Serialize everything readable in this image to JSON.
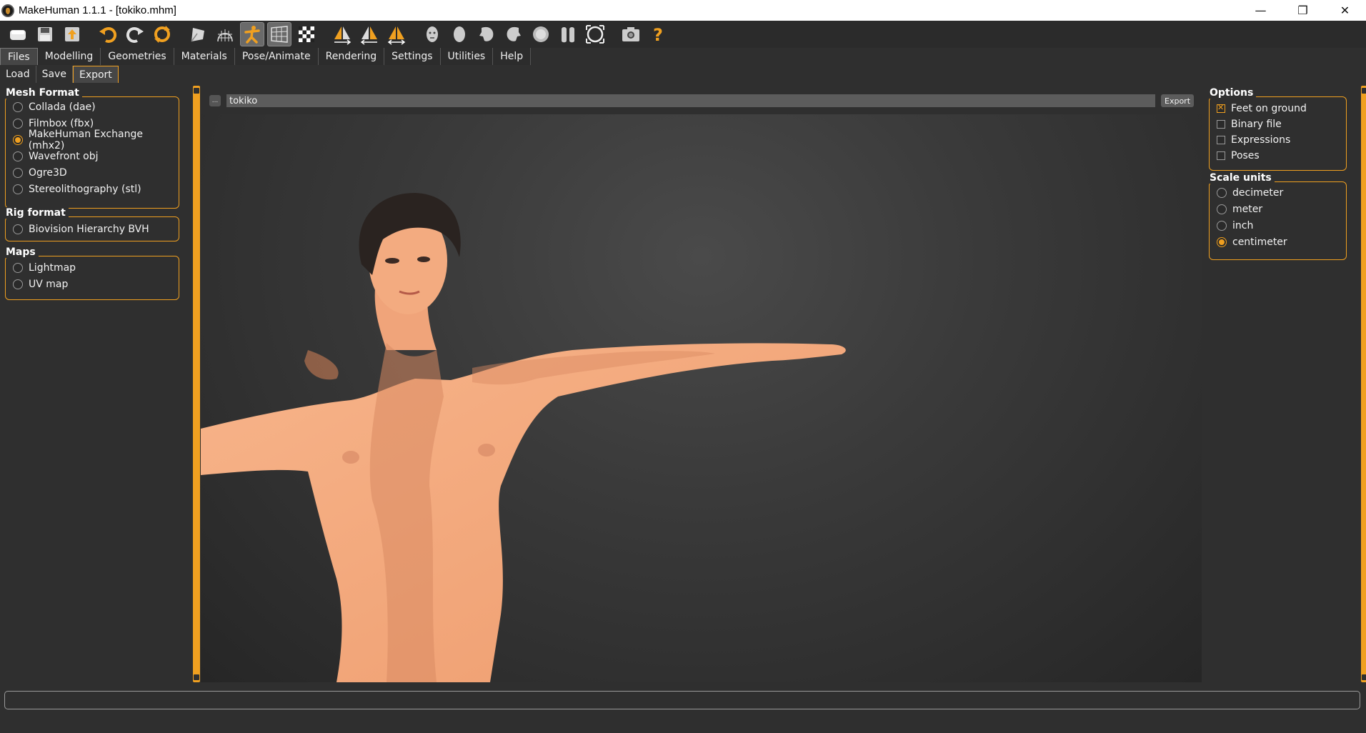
{
  "window": {
    "title": "MakeHuman 1.1.1 - [tokiko.mhm]",
    "minimize": "—",
    "restore": "❐",
    "close": "✕"
  },
  "toolbar": {
    "icons": [
      "new-icon",
      "save-icon",
      "export-icon",
      "undo-icon",
      "redo-icon",
      "reset-icon",
      "smooth-icon",
      "wireframe-icon",
      "pose-icon",
      "grid-icon",
      "background-icon",
      "symmetry-right-icon",
      "symmetry-left-icon",
      "symmetry-icon",
      "front-view-icon",
      "back-view-icon",
      "left-view-icon",
      "right-view-icon",
      "top-view-icon",
      "bottom-view-icon",
      "reset-camera-icon",
      "screenshot-icon",
      "help-icon"
    ]
  },
  "main_tabs": [
    "Files",
    "Modelling",
    "Geometries",
    "Materials",
    "Pose/Animate",
    "Rendering",
    "Settings",
    "Utilities",
    "Help"
  ],
  "active_main_tab": "Files",
  "sub_tabs": [
    "Load",
    "Save",
    "Export"
  ],
  "active_sub_tab": "Export",
  "left": {
    "mesh_format": {
      "title": "Mesh Format",
      "options": [
        "Collada (dae)",
        "Filmbox (fbx)",
        "MakeHuman Exchange (mhx2)",
        "Wavefront obj",
        "Ogre3D",
        "Stereolithography (stl)"
      ],
      "selected": "MakeHuman Exchange (mhx2)"
    },
    "rig_format": {
      "title": "Rig format",
      "options": [
        "Biovision Hierarchy BVH"
      ]
    },
    "maps": {
      "title": "Maps",
      "options": [
        "Lightmap",
        "UV map"
      ]
    }
  },
  "file_row": {
    "dots": "...",
    "filename": "tokiko",
    "export_label": "Export"
  },
  "right": {
    "options": {
      "title": "Options",
      "items": [
        {
          "label": "Feet on ground",
          "checked": true
        },
        {
          "label": "Binary file",
          "checked": false
        },
        {
          "label": "Expressions",
          "checked": false
        },
        {
          "label": "Poses",
          "checked": false
        }
      ]
    },
    "scale_units": {
      "title": "Scale units",
      "options": [
        "decimeter",
        "meter",
        "inch",
        "centimeter"
      ],
      "selected": "centimeter"
    }
  },
  "colors": {
    "accent": "#f0a020",
    "background": "#2f2f2f",
    "skin": "#f2a67c"
  }
}
